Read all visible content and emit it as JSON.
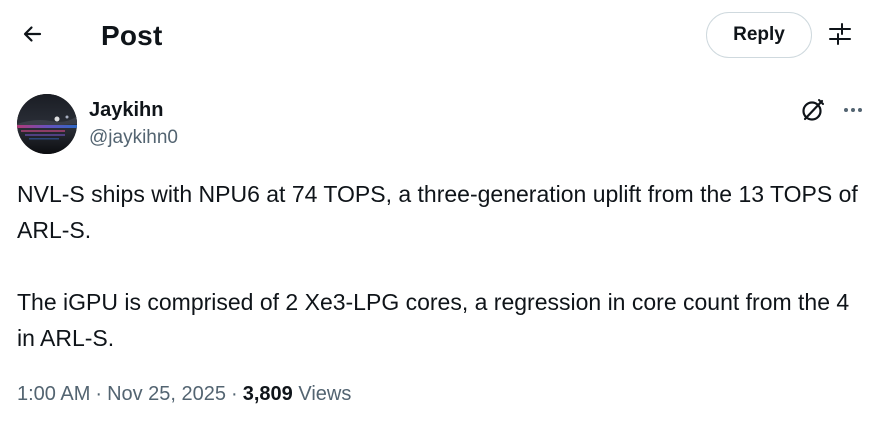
{
  "header": {
    "title": "Post",
    "reply_label": "Reply",
    "back_icon": "back-arrow-icon",
    "settings_icon": "sliders-icon"
  },
  "author": {
    "display_name": "Jaykihn",
    "handle": "@jaykihn0"
  },
  "tweet": {
    "paragraphs": [
      "NVL-S ships with NPU6 at 74 TOPS, a three-generation uplift from the 13 TOPS of ARL-S.",
      "The iGPU is comprised of 2 Xe3-LPG cores, a regression in core count from the 4 in ARL-S."
    ],
    "time": "1:00 AM",
    "date": "Nov 25, 2025",
    "separator": "·",
    "views_count": "3,809",
    "views_label": "Views"
  },
  "colors": {
    "text": "#0f1419",
    "secondary": "#536471",
    "border": "#cfd9de"
  }
}
